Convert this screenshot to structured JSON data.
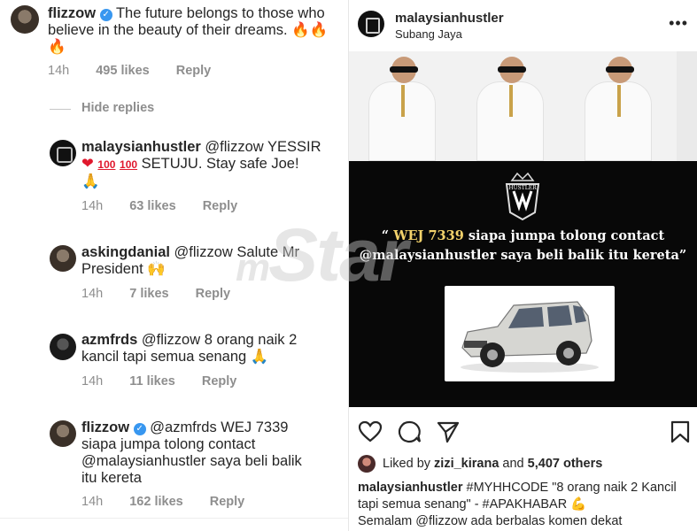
{
  "comments": [
    {
      "username": "flizzow",
      "text": "The future belongs to those who believe in the beauty of their dreams.",
      "emoji": "🔥🔥🔥",
      "time": "14h",
      "likes": "495 likes",
      "reply": "Reply"
    },
    {
      "username": "malaysianhustler",
      "mention": "@flizzow",
      "text_before": "YESSIR",
      "text_after": "SETUJU. Stay safe Joe!",
      "time": "14h",
      "likes": "63 likes",
      "reply": "Reply"
    },
    {
      "username": "askingdanial",
      "mention": "@flizzow",
      "text": "Salute Mr President",
      "time": "14h",
      "likes": "7 likes",
      "reply": "Reply"
    },
    {
      "username": "azmfrds",
      "mention": "@flizzow",
      "text": "8 orang naik 2 kancil tapi semua senang",
      "time": "14h",
      "likes": "11 likes",
      "reply": "Reply"
    },
    {
      "username": "flizzow",
      "mention": "@azmfrds",
      "text": "WEJ 7339 siapa jumpa tolong contact @malaysianhustler saya beli balik itu kereta",
      "time": "14h",
      "likes": "162 likes",
      "reply": "Reply"
    }
  ],
  "hide_replies": "Hide replies",
  "post": {
    "username": "malaysianhustler",
    "location": "Subang Jaya",
    "poster_quote_open": "“",
    "poster_plate": "WEJ 7339",
    "poster_quote_line1": "siapa jumpa tolong contact",
    "poster_quote_line2": "@malaysianhustler saya beli balik itu kereta”",
    "crest_text": "HUSTLER",
    "liked_by_prefix": "Liked by",
    "liked_by_user": "zizi_kirana",
    "liked_by_and": "and",
    "liked_by_count": "5,407 others",
    "caption_user": "malaysianhustler",
    "caption_text": "#MYHHCODE \"8 orang naik 2 Kancil tapi semua senang\" - #APAKHABAR",
    "caption_text2": "Semalam @flizzow ada berbalas komen dekat"
  },
  "watermark": {
    "prefix": "m",
    "text": "Star"
  },
  "colors": {
    "accent": "#3897f0",
    "muted": "#8e8e8e",
    "poster_bg": "#080808",
    "plate": "#f3d26b"
  }
}
